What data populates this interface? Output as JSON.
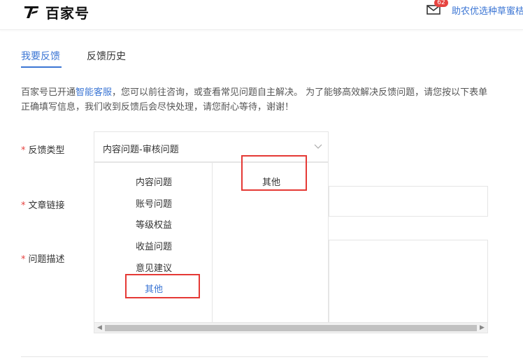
{
  "header": {
    "logo_text": "百家号",
    "notification_count": "62",
    "username": "助农优选种草蜜桔"
  },
  "tabs": {
    "feedback": "我要反馈",
    "history": "反馈历史"
  },
  "intro": {
    "part1": "百家号已开通",
    "link": "智能客服",
    "part2": "，您可以前往咨询，或查看常见问题自主解决。 为了能够高效解决反馈问题，请您按以下表单正确填写信息，我们收到反馈后会尽快处理，请您耐心等待，谢谢！"
  },
  "form": {
    "required_mark": "*",
    "type_label": "反馈类型",
    "link_label": "文章链接",
    "desc_label": "问题描述",
    "type_value": "内容问题-审核问题"
  },
  "dropdown": {
    "primary": [
      "内容问题",
      "账号问题",
      "等级权益",
      "收益问题",
      "意见建议",
      "其他"
    ],
    "secondary": [
      "其他"
    ]
  },
  "colors": {
    "accent": "#3c76d4",
    "highlight_box": "#e53935",
    "required": "#e64340"
  }
}
